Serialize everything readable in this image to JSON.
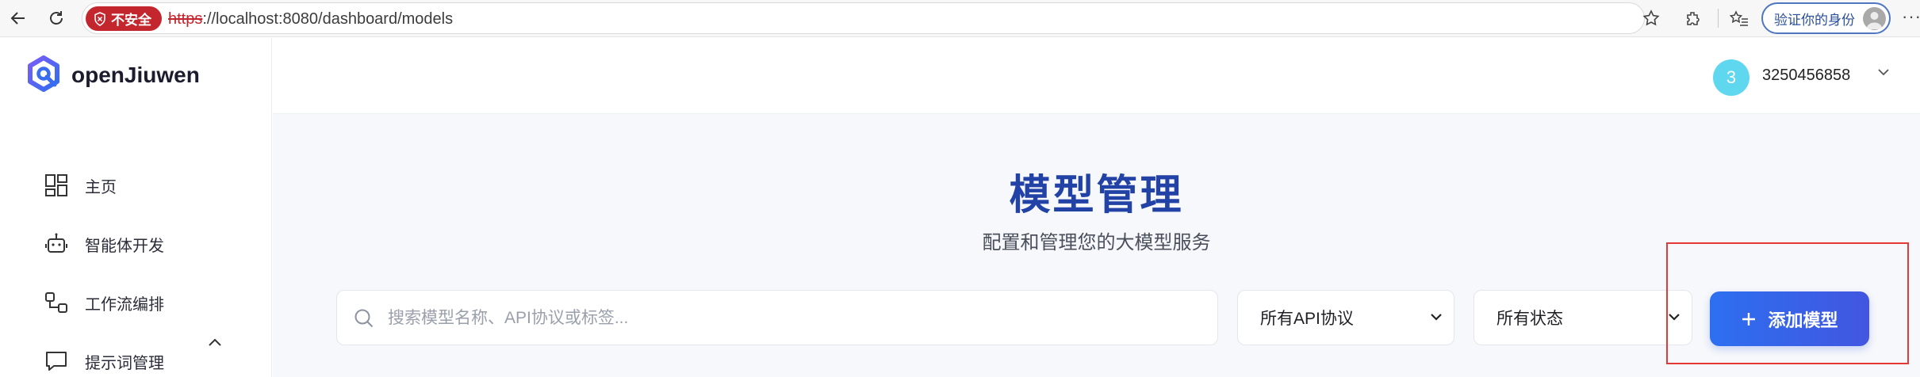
{
  "browser": {
    "security_label": "不安全",
    "url_scheme": "https",
    "url_rest": "://localhost:8080/dashboard/models",
    "verify_label": "验证你的身份",
    "more": "···"
  },
  "sidebar": {
    "brand": "openJiuwen",
    "items": [
      {
        "label": "主页",
        "icon": "grid-icon"
      },
      {
        "label": "智能体开发",
        "icon": "robot-icon"
      },
      {
        "label": "工作流编排",
        "icon": "workflow-icon"
      },
      {
        "label": "提示词管理",
        "icon": "chat-icon"
      }
    ]
  },
  "header": {
    "avatar_initial": "3",
    "username": "3250456858"
  },
  "main": {
    "title": "模型管理",
    "subtitle": "配置和管理您的大模型服务",
    "search_placeholder": "搜索模型名称、API协议或标签...",
    "protocol_filter": "所有API协议",
    "status_filter": "所有状态",
    "add_button": "添加模型"
  },
  "colors": {
    "accent": "#2d6ff0",
    "title": "#2242a6",
    "danger": "#c4262e",
    "highlight": "#e53935"
  }
}
